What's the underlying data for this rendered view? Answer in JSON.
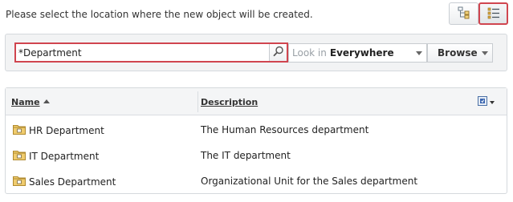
{
  "instruction": "Please select the location where the new object will be created.",
  "view_toggle": {
    "tree_icon": "hierarchy-tree-icon",
    "list_icon": "list-view-icon",
    "selected": "list"
  },
  "search": {
    "value": "*Department",
    "icon": "search-icon",
    "look_in_label": "Look in",
    "look_in_value": "Everywhere",
    "browse_label": "Browse"
  },
  "table": {
    "columns": {
      "name": "Name",
      "description": "Description"
    },
    "sort": "ascending",
    "rows": [
      {
        "name": "HR Department",
        "description": "The Human Resources department",
        "icon": "organizational-unit-folder-icon"
      },
      {
        "name": "IT Department",
        "description": "The IT department",
        "icon": "organizational-unit-folder-icon"
      },
      {
        "name": "Sales Department",
        "description": "Organizational Unit for the Sales department",
        "icon": "organizational-unit-folder-icon"
      }
    ]
  },
  "colors": {
    "highlight": "#d0454f",
    "panel": "#f2f3f4",
    "folder": "#e6b84c"
  }
}
